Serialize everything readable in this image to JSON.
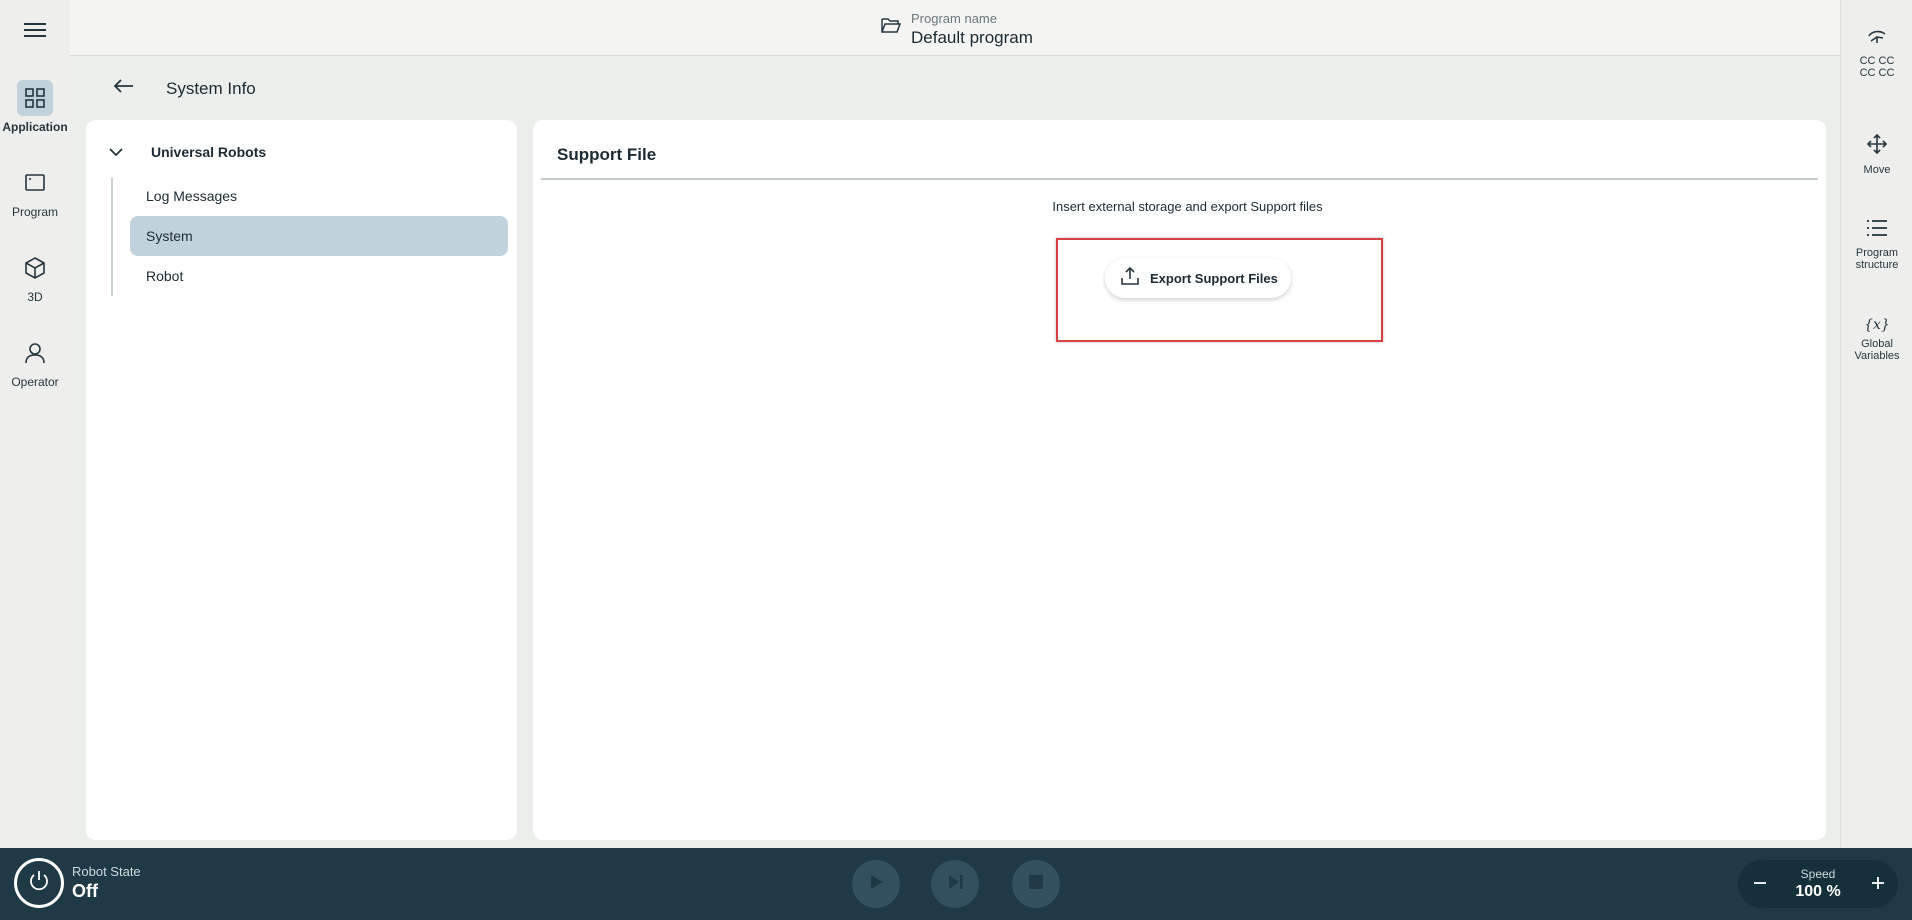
{
  "left_rail": {
    "items": [
      {
        "label": "Application",
        "icon": "grid-icon",
        "active": true
      },
      {
        "label": "Program",
        "icon": "window-icon",
        "active": false
      },
      {
        "label": "3D",
        "icon": "cube-icon",
        "active": false
      },
      {
        "label": "Operator",
        "icon": "person-icon",
        "active": false
      }
    ]
  },
  "header": {
    "program_caption": "Program name",
    "program_name": "Default program"
  },
  "right_rail": {
    "items": [
      {
        "label": "CC CC\nCC CC",
        "label_line1": "CC CC",
        "label_line2": "CC CC",
        "icon": "tcp-icon"
      },
      {
        "label": "Move",
        "icon": "move-arrows-icon"
      },
      {
        "label_line1": "Program",
        "label_line2": "structure",
        "icon": "list-icon"
      },
      {
        "label_line1": "Global",
        "label_line2": "Variables",
        "icon": "variable-icon"
      }
    ]
  },
  "page": {
    "title": "System Info"
  },
  "tree": {
    "root": "Universal Robots",
    "items": [
      {
        "label": "Log Messages",
        "active": false
      },
      {
        "label": "System",
        "active": true
      },
      {
        "label": "Robot",
        "active": false
      }
    ]
  },
  "content": {
    "title": "Support File",
    "instruction": "Insert external storage and export Support files",
    "export_button": "Export Support Files"
  },
  "bottom_bar": {
    "robot_state_label": "Robot State",
    "robot_state_value": "Off",
    "speed_label": "Speed",
    "speed_value": "100 %"
  },
  "colors": {
    "accent_active": "#c2d2dd",
    "bottom_bar": "#1f3946",
    "highlight": "#d9403f"
  }
}
